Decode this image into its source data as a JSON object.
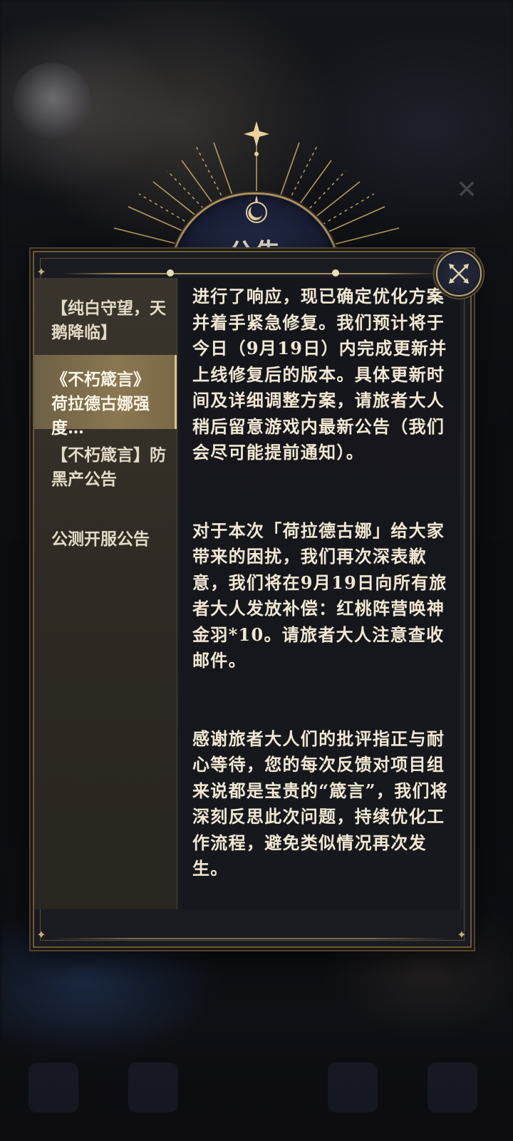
{
  "dialog": {
    "title": "公告",
    "close_icon": "close-icon"
  },
  "sidebar": {
    "items": [
      {
        "label": "【纯白守望，天鹅降临】",
        "active": false
      },
      {
        "label": "《不朽箴言》荷拉德古娜强度…",
        "active": true
      },
      {
        "label": "【不朽箴言】防黑产公告",
        "active": false
      },
      {
        "label": "公测开服公告",
        "active": false
      }
    ]
  },
  "content": {
    "paragraphs": [
      "进行了响应，现已确定优化方案并着手紧急修复。我们预计将于今日（9月19日）内完成更新并上线修复后的版本。具体更新时间及详细调整方案，请旅者大人稍后留意游戏内最新公告（我们会尽可能提前通知）。",
      "对于本次「荷拉德古娜」给大家带来的困扰，我们再次深表歉意，我们将在9月19日向所有旅者大人发放补偿：红桃阵营唤神金羽*10。请旅者大人注意查收邮件。",
      "感谢旅者大人们的批评指正与耐心等待，您的每次反馈对项目组来说都是宝贵的“箴言”，我们将深刻反思此次问题，持续优化工作流程，避免类似情况再次发生。"
    ]
  },
  "colors": {
    "accent_gold": "#a98f5b",
    "text": "#f1e8d2",
    "panel_bg": "#17181e"
  }
}
